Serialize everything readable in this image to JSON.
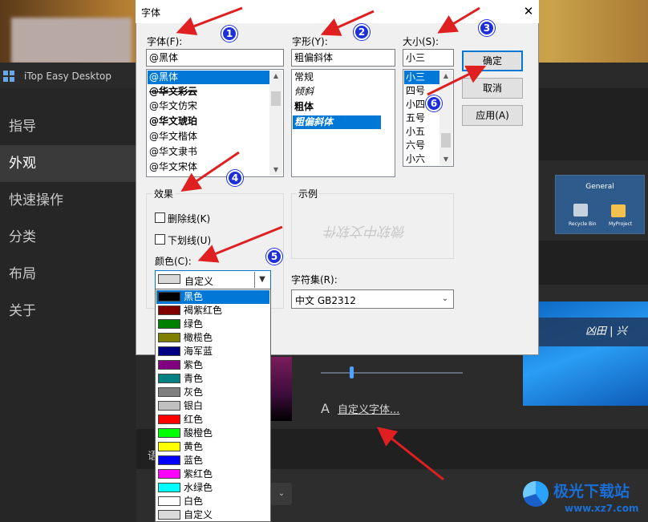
{
  "app": {
    "title": "iTop Easy Desktop",
    "sidebar": [
      "指导",
      "外观",
      "快速操作",
      "分类",
      "布局",
      "关于"
    ],
    "active_sidebar": "外观",
    "preview_title": "General",
    "preview_icons": [
      "Recycle Bin",
      "MyProject"
    ],
    "wallpaper_text": "凶田 | 兴",
    "custom_font_icon": "A",
    "custom_font_link": "自定义字体...",
    "cut_label": "语",
    "dropdown_glyph": "⌄"
  },
  "dialog": {
    "title": "字体",
    "close_glyph": "✕",
    "font": {
      "label": "字体(F):",
      "value": "@黑体",
      "items": [
        "@黑体",
        "@华文彩云",
        "@华文仿宋",
        "@华文琥珀",
        "@华文楷体",
        "@华文隶书",
        "@华文宋体"
      ],
      "selected": "@黑体"
    },
    "style": {
      "label": "字形(Y):",
      "value": "粗偏斜体",
      "items": [
        "常规",
        "倾斜",
        "粗体",
        "粗偏斜体"
      ],
      "selected": "粗偏斜体"
    },
    "size": {
      "label": "大小(S):",
      "value": "小三",
      "items": [
        "小三",
        "四号",
        "小四",
        "五号",
        "小五",
        "六号",
        "小六"
      ],
      "selected": "小三"
    },
    "buttons": {
      "ok": "确定",
      "cancel": "取消",
      "apply": "应用(A)"
    },
    "effects": {
      "label": "效果",
      "strikeout": "删除线(K)",
      "underline": "下划线(U)",
      "color_label": "颜色(C):",
      "color_value": "自定义"
    },
    "sample": {
      "label": "示例",
      "text": "微软中文软件"
    },
    "charset": {
      "label": "字符集(R):",
      "value": "中文 GB2312"
    },
    "colors": [
      {
        "name": "黑色",
        "hex": "#000000"
      },
      {
        "name": "褐紫红色",
        "hex": "#800000"
      },
      {
        "name": "绿色",
        "hex": "#008000"
      },
      {
        "name": "橄榄色",
        "hex": "#808000"
      },
      {
        "name": "海军蓝",
        "hex": "#000080"
      },
      {
        "name": "紫色",
        "hex": "#800080"
      },
      {
        "name": "青色",
        "hex": "#008080"
      },
      {
        "name": "灰色",
        "hex": "#808080"
      },
      {
        "name": "银白",
        "hex": "#c0c0c0"
      },
      {
        "name": "红色",
        "hex": "#ff0000"
      },
      {
        "name": "酸橙色",
        "hex": "#00ff00"
      },
      {
        "name": "黄色",
        "hex": "#ffff00"
      },
      {
        "name": "蓝色",
        "hex": "#0000ff"
      },
      {
        "name": "紫红色",
        "hex": "#ff00ff"
      },
      {
        "name": "水绿色",
        "hex": "#00ffff"
      },
      {
        "name": "白色",
        "hex": "#ffffff"
      },
      {
        "name": "自定义",
        "hex": "#d9d9d9"
      }
    ],
    "selected_color": "黑色"
  },
  "annotations": {
    "badges": [
      "1",
      "2",
      "3",
      "4",
      "5",
      "6"
    ],
    "arrow_color": "#e02020"
  },
  "watermark": {
    "title": "极光下载站",
    "url": "www.xz7.com"
  }
}
